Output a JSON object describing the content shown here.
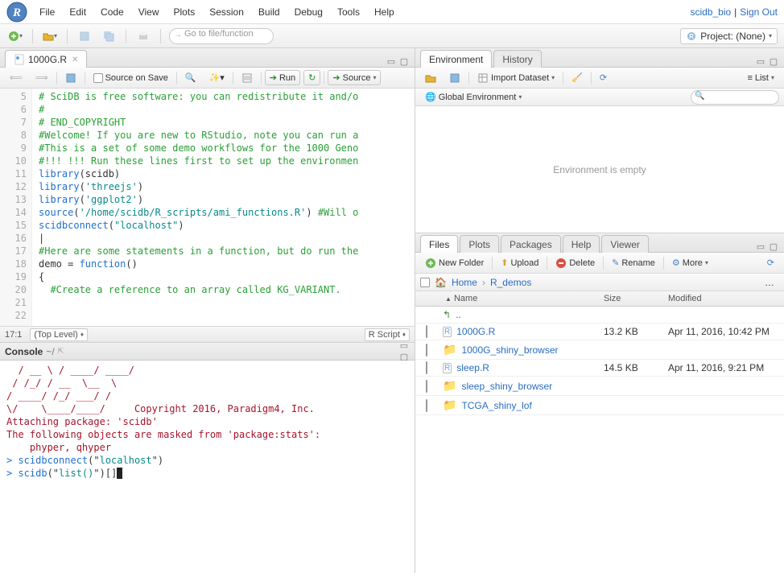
{
  "menubar": {
    "items": [
      "File",
      "Edit",
      "Code",
      "View",
      "Plots",
      "Session",
      "Build",
      "Debug",
      "Tools",
      "Help"
    ],
    "user": "scidb_bio",
    "signout": "Sign Out"
  },
  "toolbar": {
    "goto_placeholder": "Go to file/function",
    "project_label": "Project: (None)"
  },
  "source": {
    "tab_label": "1000G.R",
    "source_on_save": "Source on Save",
    "run_label": "Run",
    "source_btn": "Source",
    "statusbar": {
      "pos": "17:1",
      "scope": "(Top Level)",
      "lang": "R Script"
    },
    "lines": [
      {
        "n": 5,
        "seg": [
          {
            "cls": "c",
            "t": "# SciDB is free software: you can redistribute it and/o"
          }
        ]
      },
      {
        "n": 6,
        "seg": [
          {
            "cls": "c",
            "t": "#"
          }
        ]
      },
      {
        "n": 7,
        "seg": [
          {
            "cls": "c",
            "t": "# END_COPYRIGHT"
          }
        ]
      },
      {
        "n": 8,
        "seg": [
          {
            "cls": "nrm",
            "t": ""
          }
        ]
      },
      {
        "n": 9,
        "seg": [
          {
            "cls": "c",
            "t": "#Welcome! If you are new to RStudio, note you can run a"
          }
        ]
      },
      {
        "n": 10,
        "seg": [
          {
            "cls": "c",
            "t": "#This is a set of some demo workflows for the 1000 Geno"
          }
        ]
      },
      {
        "n": 11,
        "seg": [
          {
            "cls": "c",
            "t": "#!!! !!! Run these lines first to set up the environmen"
          }
        ]
      },
      {
        "n": 12,
        "seg": [
          {
            "cls": "k",
            "t": "library"
          },
          {
            "cls": "nrm",
            "t": "(scidb)"
          }
        ]
      },
      {
        "n": 13,
        "seg": [
          {
            "cls": "k",
            "t": "library"
          },
          {
            "cls": "nrm",
            "t": "("
          },
          {
            "cls": "s",
            "t": "'threejs'"
          },
          {
            "cls": "nrm",
            "t": ")"
          }
        ]
      },
      {
        "n": 14,
        "seg": [
          {
            "cls": "k",
            "t": "library"
          },
          {
            "cls": "nrm",
            "t": "("
          },
          {
            "cls": "s",
            "t": "'ggplot2'"
          },
          {
            "cls": "nrm",
            "t": ")"
          }
        ]
      },
      {
        "n": 15,
        "seg": [
          {
            "cls": "k",
            "t": "source"
          },
          {
            "cls": "nrm",
            "t": "("
          },
          {
            "cls": "s",
            "t": "'/home/scidb/R_scripts/ami_functions.R'"
          },
          {
            "cls": "nrm",
            "t": ") "
          },
          {
            "cls": "c",
            "t": "#Will o"
          }
        ]
      },
      {
        "n": 16,
        "seg": [
          {
            "cls": "k",
            "t": "scidbconnect"
          },
          {
            "cls": "nrm",
            "t": "("
          },
          {
            "cls": "s",
            "t": "\"localhost\""
          },
          {
            "cls": "nrm",
            "t": ")"
          }
        ]
      },
      {
        "n": 17,
        "seg": [
          {
            "cls": "nrm",
            "t": "|"
          }
        ]
      },
      {
        "n": 18,
        "seg": [
          {
            "cls": "c",
            "t": "#Here are some statements in a function, but do run the"
          }
        ]
      },
      {
        "n": 19,
        "seg": [
          {
            "cls": "nrm",
            "t": "demo = "
          },
          {
            "cls": "k",
            "t": "function"
          },
          {
            "cls": "nrm",
            "t": "()"
          }
        ]
      },
      {
        "n": 20,
        "seg": [
          {
            "cls": "nrm",
            "t": "{"
          }
        ]
      },
      {
        "n": 21,
        "seg": [
          {
            "cls": "c",
            "t": "  #Create a reference to an array called KG_VARIANT. "
          }
        ]
      },
      {
        "n": 22,
        "seg": [
          {
            "cls": "nrm",
            "t": ""
          }
        ]
      }
    ]
  },
  "console": {
    "title": "Console",
    "path": "~/",
    "lines": [
      {
        "cls": "r",
        "t": "  / __ \\ / ____/ ____/"
      },
      {
        "cls": "r",
        "t": " / /_/ / __  \\__  \\"
      },
      {
        "cls": "r",
        "t": "/ ____/ /_/ ___/ /"
      },
      {
        "cls": "r",
        "t": "\\/    \\____/____/     Copyright 2016, Paradigm4, Inc."
      },
      {
        "cls": "r",
        "t": ""
      },
      {
        "cls": "r",
        "t": ""
      },
      {
        "cls": "r",
        "t": "Attaching package: 'scidb'"
      },
      {
        "cls": "r",
        "t": ""
      },
      {
        "cls": "r",
        "t": "The following objects are masked from 'package:stats':"
      },
      {
        "cls": "r",
        "t": ""
      },
      {
        "cls": "r",
        "t": "    phyper, qhyper"
      },
      {
        "cls": "r",
        "t": ""
      }
    ],
    "prompt1": {
      "pre": "> ",
      "fn": "scidbconnect",
      "open": "(\"",
      "str": "localhost",
      "close": "\")"
    },
    "prompt2": {
      "pre": "> ",
      "fn": "scidb",
      "open": "(\"",
      "str": "list()",
      "close": "\")[]"
    }
  },
  "env": {
    "tab1": "Environment",
    "tab2": "History",
    "import": "Import Dataset",
    "list_label": "List",
    "global_env": "Global Environment",
    "empty": "Environment is empty"
  },
  "files": {
    "tabs": [
      "Files",
      "Plots",
      "Packages",
      "Help",
      "Viewer"
    ],
    "btns": {
      "newfolder": "New Folder",
      "upload": "Upload",
      "delete": "Delete",
      "rename": "Rename",
      "more": "More"
    },
    "crumbs": [
      "Home",
      "R_demos"
    ],
    "cols": {
      "name": "Name",
      "size": "Size",
      "modified": "Modified"
    },
    "rows": [
      {
        "type": "up",
        "name": ".."
      },
      {
        "type": "rfile",
        "name": "1000G.R",
        "size": "13.2 KB",
        "modified": "Apr 11, 2016, 10:42 PM"
      },
      {
        "type": "folder",
        "name": "1000G_shiny_browser"
      },
      {
        "type": "rfile",
        "name": "sleep.R",
        "size": "14.5 KB",
        "modified": "Apr 11, 2016, 9:21 PM"
      },
      {
        "type": "folder",
        "name": "sleep_shiny_browser"
      },
      {
        "type": "folder",
        "name": "TCGA_shiny_lof"
      }
    ]
  }
}
